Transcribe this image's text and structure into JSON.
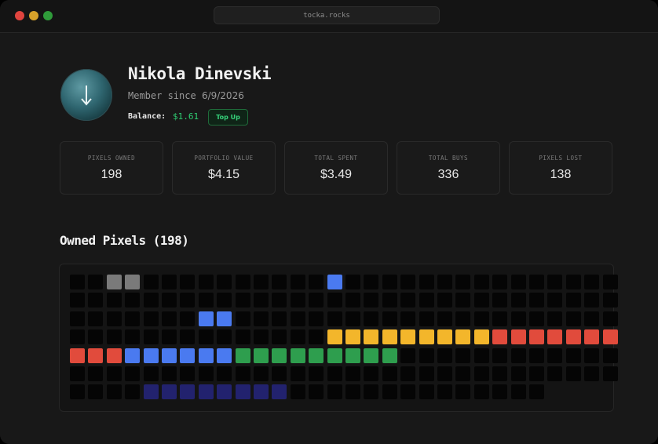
{
  "browser": {
    "url": "tocka.rocks"
  },
  "profile": {
    "name": "Nikola Dinevski",
    "member_prefix": "Member since",
    "member_date": "6/9/2026",
    "balance_label": "Balance:",
    "balance_value": "$1.61",
    "topup_label": "Top Up",
    "avatar_icon": "arrow-down-icon"
  },
  "stats": [
    {
      "label": "PIXELS OWNED",
      "value": "198"
    },
    {
      "label": "PORTFOLIO VALUE",
      "value": "$4.15"
    },
    {
      "label": "TOTAL SPENT",
      "value": "$3.49"
    },
    {
      "label": "TOTAL BUYS",
      "value": "336"
    },
    {
      "label": "PIXELS LOST",
      "value": "138"
    }
  ],
  "owned_pixels": {
    "title": "Owned Pixels (198)",
    "colors": {
      "k": "#050505",
      "g": "#7a7a7a",
      "b": "#4a7af0",
      "y": "#f3b62b",
      "r": "#e14b3c",
      "n": "#2e9e4e",
      "d": "#22226e"
    },
    "rows": [
      "kkggkkkkkkkkkkbkkkkkkkkkkkkkkk",
      "kkkkkkkkkkkkkkkkkkkkkkkkkkkkkk",
      "kkkkkkkbbkkkkkkkkkkkkkkkkkkkkk",
      "kkkkkkkkkkkkkkyyyyyyyyyrrrrrrr",
      "rrrbbbbbbnnnnnnnnnkkkkkkkkkkkk",
      "kkkkkkkkkkkkkkkkkkkkkkkkkkkkkk",
      "kkkkddddddddkkkkkkkkkkkkkk"
    ]
  }
}
